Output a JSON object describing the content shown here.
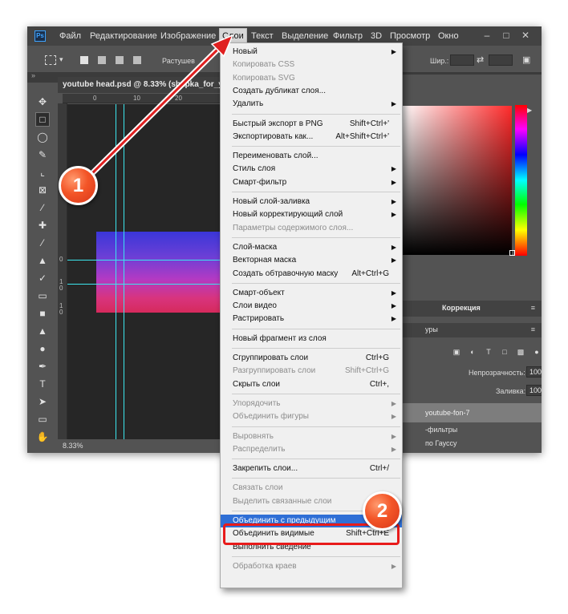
{
  "app": {
    "logo": "Ps",
    "menu": [
      "Файл",
      "Редактирование",
      "Изображение",
      "Слои",
      "Текст",
      "Выделение",
      "Фильтр",
      "3D",
      "Просмотр",
      "Окно"
    ],
    "active_menu": "Слои"
  },
  "options_bar": {
    "feather_label": "Растушев",
    "width_label": "Шир.:"
  },
  "document": {
    "tab_title": "youtube head.psd @ 8.33% (shapka_for_yo",
    "zoom": "8.33%",
    "ruler_top_ticks": [
      "0",
      "10",
      "20"
    ],
    "ruler_left_ticks": [
      "0",
      "1",
      "0",
      "1",
      "0"
    ]
  },
  "right_panel": {
    "correction_tab": "Коррекция",
    "layers_tab_partial": "уры",
    "opacity_label": "Непрозрачность:",
    "opacity_value": "100%",
    "fill_label": "Заливка:",
    "fill_value": "100%",
    "layer_name": "youtube-fon-7",
    "layer_effect_1": "-фильтры",
    "layer_effect_2": "по Гауссу"
  },
  "dropdown": {
    "items": [
      {
        "label": "Новый",
        "shortcut": "",
        "submenu": true,
        "disabled": false
      },
      {
        "label": "Копировать CSS",
        "shortcut": "",
        "submenu": false,
        "disabled": true
      },
      {
        "label": "Копировать SVG",
        "shortcut": "",
        "submenu": false,
        "disabled": true
      },
      {
        "label": "Создать дубликат слоя...",
        "shortcut": "",
        "submenu": false,
        "disabled": false
      },
      {
        "label": "Удалить",
        "shortcut": "",
        "submenu": true,
        "disabled": false
      },
      {
        "sep": true
      },
      {
        "label": "Быстрый экспорт в PNG",
        "shortcut": "Shift+Ctrl+'",
        "submenu": false,
        "disabled": false
      },
      {
        "label": "Экспортировать как...",
        "shortcut": "Alt+Shift+Ctrl+'",
        "submenu": false,
        "disabled": false
      },
      {
        "sep": true
      },
      {
        "label": "Переименовать слой...",
        "shortcut": "",
        "submenu": false,
        "disabled": false
      },
      {
        "label": "Стиль слоя",
        "shortcut": "",
        "submenu": true,
        "disabled": false
      },
      {
        "label": "Смарт-фильтр",
        "shortcut": "",
        "submenu": true,
        "disabled": false
      },
      {
        "sep": true
      },
      {
        "label": "Новый слой-заливка",
        "shortcut": "",
        "submenu": true,
        "disabled": false
      },
      {
        "label": "Новый корректирующий слой",
        "shortcut": "",
        "submenu": true,
        "disabled": false
      },
      {
        "label": "Параметры содержимого слоя...",
        "shortcut": "",
        "submenu": false,
        "disabled": true
      },
      {
        "sep": true
      },
      {
        "label": "Слой-маска",
        "shortcut": "",
        "submenu": true,
        "disabled": false
      },
      {
        "label": "Векторная маска",
        "shortcut": "",
        "submenu": true,
        "disabled": false
      },
      {
        "label": "Создать обтравочную маску",
        "shortcut": "Alt+Ctrl+G",
        "submenu": false,
        "disabled": false
      },
      {
        "sep": true
      },
      {
        "label": "Смарт-объект",
        "shortcut": "",
        "submenu": true,
        "disabled": false
      },
      {
        "label": "Слои видео",
        "shortcut": "",
        "submenu": true,
        "disabled": false
      },
      {
        "label": "Растрировать",
        "shortcut": "",
        "submenu": true,
        "disabled": false
      },
      {
        "sep": true
      },
      {
        "label": "Новый фрагмент из слоя",
        "shortcut": "",
        "submenu": false,
        "disabled": false
      },
      {
        "sep": true
      },
      {
        "label": "Сгруппировать слои",
        "shortcut": "Ctrl+G",
        "submenu": false,
        "disabled": false
      },
      {
        "label": "Разгруппировать слои",
        "shortcut": "Shift+Ctrl+G",
        "submenu": false,
        "disabled": true
      },
      {
        "label": "Скрыть слои",
        "shortcut": "Ctrl+,",
        "submenu": false,
        "disabled": false
      },
      {
        "sep": true
      },
      {
        "label": "Упорядочить",
        "shortcut": "",
        "submenu": true,
        "disabled": true
      },
      {
        "label": "Объединить фигуры",
        "shortcut": "",
        "submenu": true,
        "disabled": true
      },
      {
        "sep": true
      },
      {
        "label": "Выровнять",
        "shortcut": "",
        "submenu": true,
        "disabled": true
      },
      {
        "label": "Распределить",
        "shortcut": "",
        "submenu": true,
        "disabled": true
      },
      {
        "sep": true
      },
      {
        "label": "Закрепить слои...",
        "shortcut": "Ctrl+/",
        "submenu": false,
        "disabled": false
      },
      {
        "sep": true
      },
      {
        "label": "Связать слои",
        "shortcut": "",
        "submenu": false,
        "disabled": true
      },
      {
        "label": "Выделить связанные слои",
        "shortcut": "",
        "submenu": false,
        "disabled": true
      },
      {
        "sep": true
      },
      {
        "label": "Объединить с предыдущим",
        "shortcut": "Ctrl+E",
        "submenu": false,
        "disabled": false,
        "highlight": true
      },
      {
        "label": "Объединить видимые",
        "shortcut": "Shift+Ctrl+E",
        "submenu": false,
        "disabled": false
      },
      {
        "label": "Выполнить сведение",
        "shortcut": "",
        "submenu": false,
        "disabled": false
      },
      {
        "sep": true
      },
      {
        "label": "Обработка краев",
        "shortcut": "",
        "submenu": true,
        "disabled": true
      }
    ]
  },
  "annotations": {
    "step1": "1",
    "step2": "2",
    "accent_color": "#e81b1b",
    "badge_color": "#f35527"
  }
}
